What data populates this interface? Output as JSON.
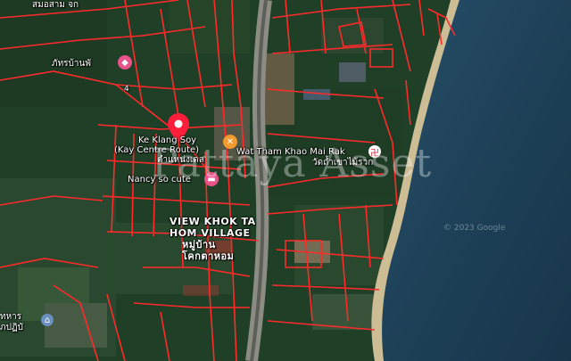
{
  "map": {
    "labels": {
      "top_th": "สมอสาม จก",
      "village_th": "ภัทรบ้านพั",
      "road_number": "4",
      "pin_name_line1": "Ke Klang Soy",
      "pin_name_line2": "(Kay Centre Route)",
      "pin_name_th": "ตำแหน่งเดล",
      "nancy": "Nancy so cute",
      "temple_en": "Wat Tham Khao Mai Rak",
      "temple_th": "วัดถ้ำเขาไม้รวก",
      "view_line1": "VIEW KHOK TA",
      "view_line2": "HOM VILLAGE",
      "view_th1": "หมู่บ้าน",
      "view_th2": "โคกตาหอม",
      "military_th1": "ทหาร",
      "military_th2": "ภปฏิบั"
    },
    "watermark": "Pattaya Asset",
    "copyright": "© 2023 Google",
    "colors": {
      "plot_lines": "#ff2a2a",
      "pin": "#ff1f3a",
      "sea": "#1e4158",
      "beach": "#d4c39a",
      "forest": "#223f26"
    },
    "icons": [
      "location-pin-icon",
      "restaurant-icon",
      "temple-icon",
      "shopping-icon",
      "lodging-icon",
      "museum-icon"
    ]
  }
}
